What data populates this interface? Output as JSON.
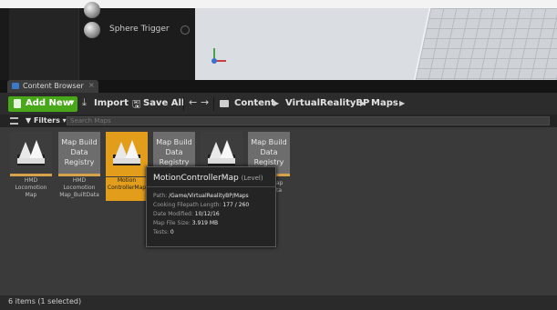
{
  "placement": {
    "items": [
      {
        "label": ""
      },
      {
        "label": "Sphere Trigger"
      }
    ]
  },
  "content_browser": {
    "tab_label": "Content Browser",
    "tab_close": "×",
    "toolbar": {
      "add_new": "Add New",
      "import": "Import",
      "save_all": "Save All"
    },
    "breadcrumb": [
      "Content",
      "VirtualRealityBP",
      "Maps"
    ],
    "filters_label": "Filters",
    "search_placeholder": "Search Maps",
    "assets": [
      {
        "name": "HMD Locomotion Map",
        "kind": "map"
      },
      {
        "name": "HMD Locomotion Map_BuiltData",
        "kind": "build",
        "label": "Map Build Data Registry"
      },
      {
        "name": "Motion ControllerMap",
        "kind": "map",
        "selected": true
      },
      {
        "name": "",
        "kind": "build",
        "label": "Map Build Data Registry"
      },
      {
        "name": "",
        "kind": "map"
      },
      {
        "name": "",
        "kind": "build",
        "label": "Map Build Data Registry"
      }
    ],
    "tooltip": {
      "title": "MotionControllerMap",
      "type": "(Level)",
      "rows": [
        {
          "key": "Path:",
          "value": "/Game/VirtualRealityBP/Maps"
        },
        {
          "key": "Cooking Filepath Length:",
          "value": "177 / 260"
        },
        {
          "key": "Date Modified:",
          "value": "10/12/16"
        },
        {
          "key": "Map File Size:",
          "value": "3.919 MB"
        },
        {
          "key": "Tests:",
          "value": "0"
        }
      ]
    },
    "partial_labels": [
      "ap",
      "ta"
    ],
    "status": "6 items (1 selected)"
  },
  "colors": {
    "add_new_green": "#49a71a",
    "selection_orange": "#e29d1b",
    "asset_stripe": "#d6a24a"
  }
}
